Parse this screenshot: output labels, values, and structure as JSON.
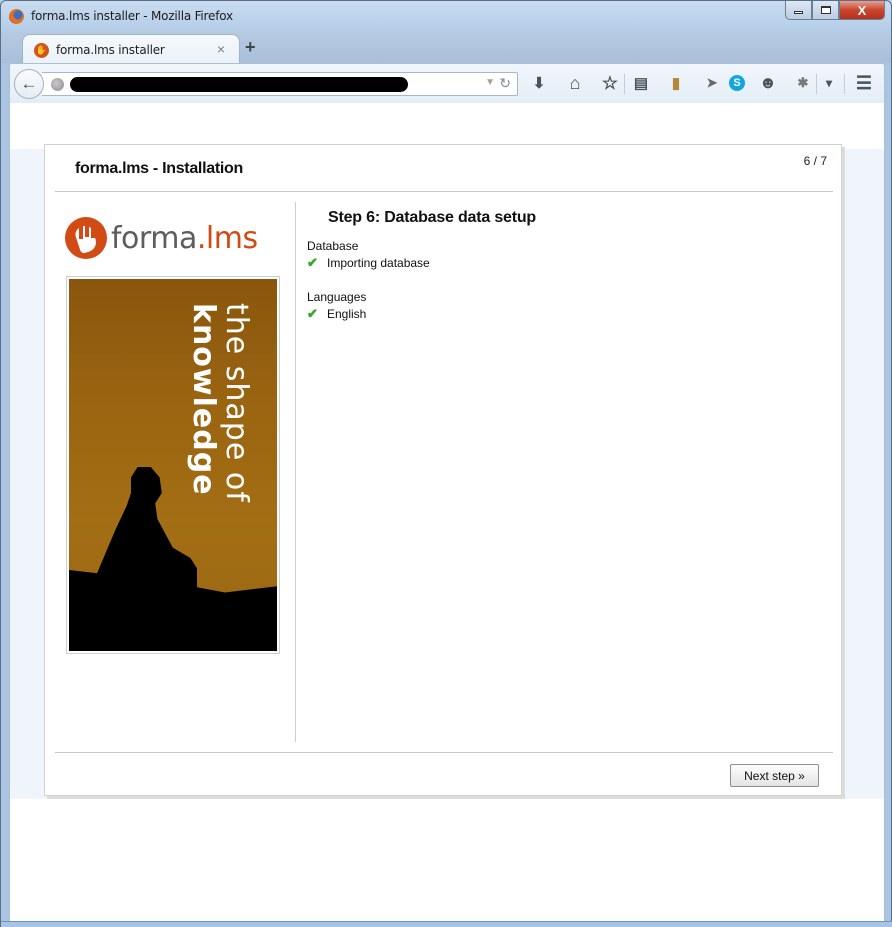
{
  "window": {
    "title": "forma.lms installer - Mozilla Firefox",
    "controls": {
      "minimize": "minimize",
      "maximize": "maximize",
      "close": "X"
    }
  },
  "tabs": [
    {
      "title": "forma.lms installer",
      "active": true,
      "close_label": "×"
    }
  ],
  "new_tab_label": "+",
  "navbar": {
    "back_label": "←",
    "url": "",
    "url_redacted": true,
    "dropmarker": "▼",
    "reload": "↻",
    "toolbar_icons": [
      {
        "name": "download-icon",
        "glyph": "⬇"
      },
      {
        "name": "home-icon",
        "glyph": "⌂"
      },
      {
        "name": "bookmark-star-icon",
        "glyph": "☆"
      },
      {
        "name": "reading-list-icon",
        "glyph": "▤"
      },
      {
        "name": "notebook-addon-icon",
        "glyph": "▮"
      },
      {
        "name": "send-icon",
        "glyph": "➤"
      },
      {
        "name": "skype-icon",
        "glyph": "S"
      },
      {
        "name": "chat-icon",
        "glyph": "☻"
      },
      {
        "name": "bug-addon-icon",
        "glyph": "✱"
      },
      {
        "name": "overflow-dropdown-icon",
        "glyph": "▾"
      },
      {
        "name": "hamburger-menu-icon",
        "glyph": "☰"
      }
    ]
  },
  "installer": {
    "title": "forma.lms - Installation",
    "step_counter": "6 / 7",
    "logo": {
      "text_main": "forma",
      "text_accent": ".lms"
    },
    "banner": {
      "line1": "the shape of",
      "line2": "knowledge"
    },
    "step_title": "Step 6: Database data setup",
    "sections": [
      {
        "label": "Database",
        "items": [
          {
            "status": "ok",
            "text": "Importing database"
          }
        ]
      },
      {
        "label": "Languages",
        "items": [
          {
            "status": "ok",
            "text": "English"
          }
        ]
      }
    ],
    "next_button": "Next step »"
  },
  "colors": {
    "brand_orange": "#d24a14",
    "check_green": "#3aa334",
    "page_background": "#f0f4fb"
  }
}
